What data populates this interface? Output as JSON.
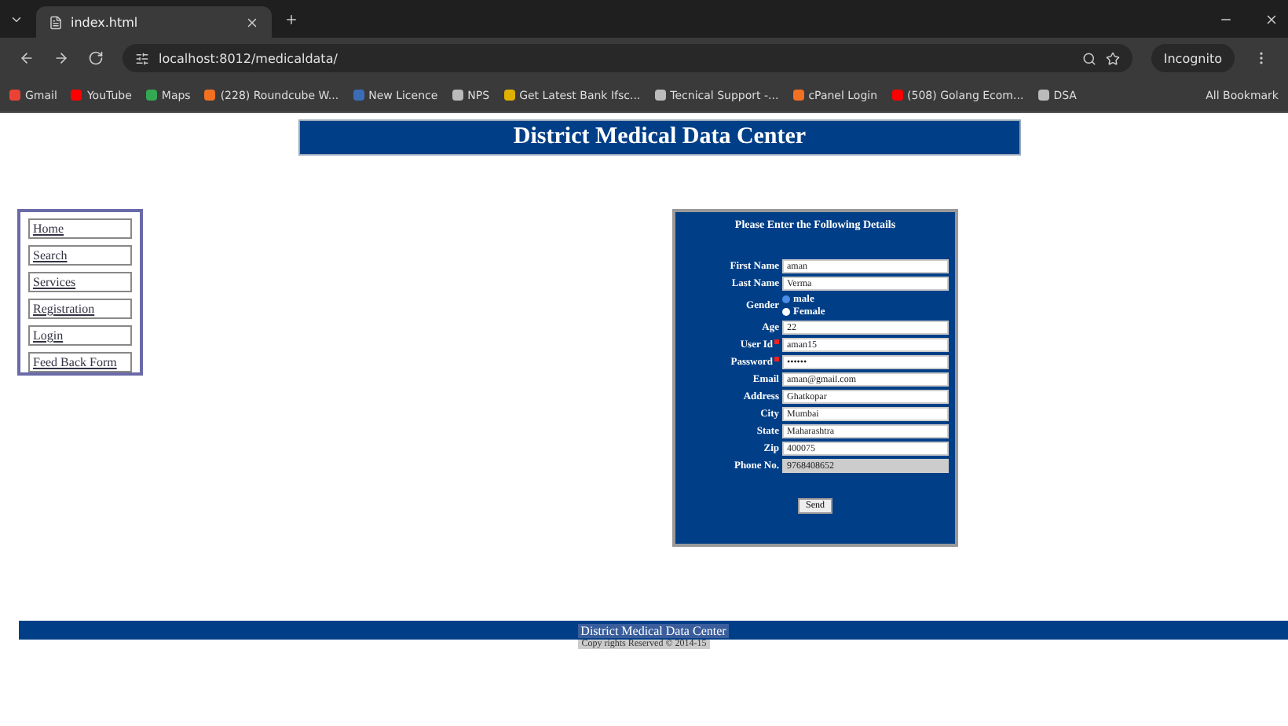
{
  "browser": {
    "tab_title": "index.html",
    "url": "localhost:8012/medicaldata/",
    "profile": "Incognito",
    "bookmarks": [
      {
        "label": "Gmail",
        "color": "#ea4335"
      },
      {
        "label": "YouTube",
        "color": "#ff0000"
      },
      {
        "label": "Maps",
        "color": "#34a853"
      },
      {
        "label": "(228) Roundcube W...",
        "color": "#f37021"
      },
      {
        "label": "New Licence",
        "color": "#3b6cb7"
      },
      {
        "label": "NPS",
        "color": "#bbbbbb"
      },
      {
        "label": "Get Latest Bank Ifsc...",
        "color": "#e0b000"
      },
      {
        "label": "Tecnical Support -...",
        "color": "#bbbbbb"
      },
      {
        "label": "cPanel Login",
        "color": "#f37021"
      },
      {
        "label": "(508) Golang Ecom...",
        "color": "#ff0000"
      },
      {
        "label": "DSA",
        "color": "#bbbbbb"
      }
    ],
    "all_bookmarks": "All Bookmark"
  },
  "header": {
    "title": "District Medical Data Center"
  },
  "nav": [
    {
      "label": "Home"
    },
    {
      "label": "Search"
    },
    {
      "label": "Services"
    },
    {
      "label": "Registration"
    },
    {
      "label": "Login"
    },
    {
      "label": "Feed Back Form"
    }
  ],
  "form": {
    "title": "Please Enter the Following Details",
    "fields": [
      {
        "kind": "text",
        "label": "First Name",
        "value": "aman"
      },
      {
        "kind": "text",
        "label": "Last Name",
        "value": "Verma"
      },
      {
        "kind": "radio",
        "label": "Gender",
        "options": [
          {
            "label": "male",
            "selected": true
          },
          {
            "label": "Female",
            "selected": false
          }
        ]
      },
      {
        "kind": "text",
        "label": "Age",
        "value": "22"
      },
      {
        "kind": "text",
        "label": "User Id",
        "value": "aman15",
        "required": true
      },
      {
        "kind": "text",
        "label": "Password",
        "value": "••••••",
        "required": true
      },
      {
        "kind": "text",
        "label": "Email",
        "value": "aman@gmail.com"
      },
      {
        "kind": "text",
        "label": "Address",
        "value": "Ghatkopar"
      },
      {
        "kind": "text",
        "label": "City",
        "value": "Mumbai"
      },
      {
        "kind": "text",
        "label": "State",
        "value": "Maharashtra"
      },
      {
        "kind": "text",
        "label": "Zip",
        "value": "400075"
      },
      {
        "kind": "text",
        "label": "Phone No.",
        "value": "9768408652",
        "disabled": true
      }
    ],
    "submit": "Send"
  },
  "footer": {
    "title": "District Medical Data Center",
    "copyright": "Copy rights Reserved © 2014-15"
  }
}
